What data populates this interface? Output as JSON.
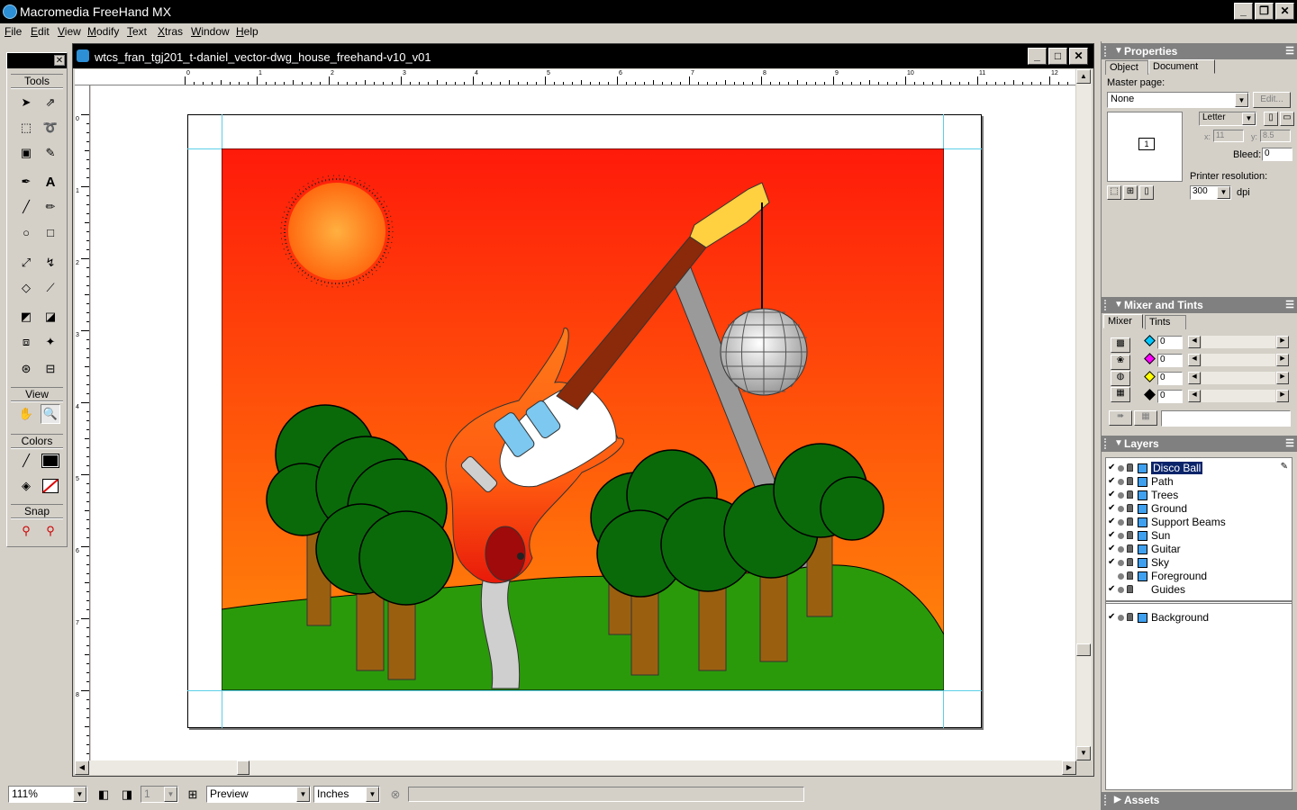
{
  "app": {
    "title": "Macromedia FreeHand MX"
  },
  "menu": [
    "File",
    "Edit",
    "View",
    "Modify",
    "Text",
    "Xtras",
    "Window",
    "Help"
  ],
  "tools": {
    "section_tools": "Tools",
    "section_view": "View",
    "section_colors": "Colors",
    "section_snap": "Snap"
  },
  "document": {
    "title": "wtcs_fran_tgj201_t-daniel_vector-dwg_house_freehand-v10_v01",
    "ruler_h": [
      "0",
      "1",
      "2",
      "3",
      "4",
      "5",
      "6",
      "7",
      "8",
      "9",
      "10",
      "11",
      "12"
    ],
    "ruler_v": [
      "0",
      "1",
      "2",
      "3",
      "4",
      "5",
      "6",
      "7",
      "8"
    ]
  },
  "status": {
    "zoom": "111%",
    "page": "1",
    "view_mode": "Preview",
    "units": "Inches"
  },
  "properties": {
    "title": "Properties",
    "tabs": [
      "Object",
      "Document"
    ],
    "master_page_label": "Master page:",
    "master_page_value": "None",
    "edit_label": "Edit...",
    "page_number": "1",
    "page_size": "Letter",
    "x_label": "x:",
    "x_value": "11",
    "y_label": "y:",
    "y_value": "8.5",
    "bleed_label": "Bleed:",
    "bleed_value": "0",
    "printer_res_label": "Printer resolution:",
    "printer_res_value": "300",
    "dpi_label": "dpi"
  },
  "mixer": {
    "title": "Mixer and Tints",
    "tabs": [
      "Mixer",
      "Tints"
    ],
    "values": [
      "0",
      "0",
      "0",
      "0"
    ],
    "colors": [
      "#00c8ff",
      "#ff00ff",
      "#ffff00",
      "#000000"
    ]
  },
  "layers": {
    "title": "Layers",
    "items": [
      {
        "name": "Disco Ball",
        "checked": true,
        "swatch": true,
        "selected": true
      },
      {
        "name": "Path",
        "checked": true,
        "swatch": true
      },
      {
        "name": "Trees",
        "checked": true,
        "swatch": true
      },
      {
        "name": "Ground",
        "checked": true,
        "swatch": true
      },
      {
        "name": "Support Beams",
        "checked": true,
        "swatch": true
      },
      {
        "name": "Sun",
        "checked": true,
        "swatch": true
      },
      {
        "name": "Guitar",
        "checked": true,
        "swatch": true
      },
      {
        "name": "Sky",
        "checked": true,
        "swatch": true
      },
      {
        "name": "Foreground",
        "checked": false,
        "swatch": true
      },
      {
        "name": "Guides",
        "checked": true,
        "swatch": false
      }
    ],
    "background": "Background"
  },
  "assets": {
    "title": "Assets"
  }
}
